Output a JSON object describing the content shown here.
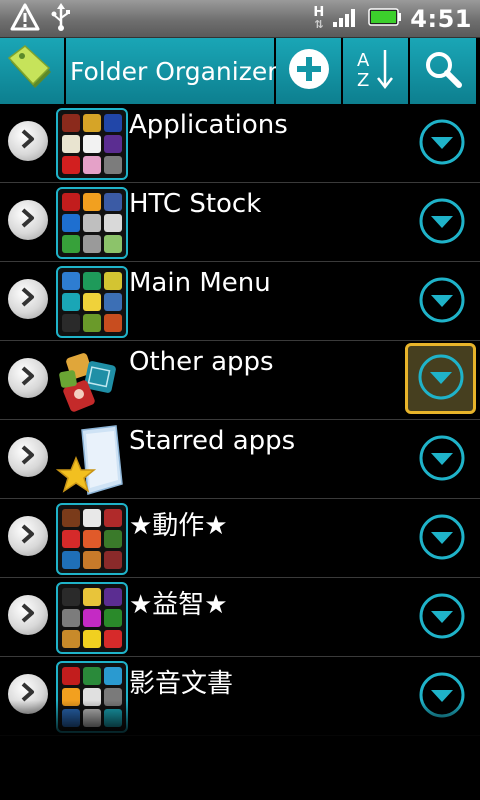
{
  "status_bar": {
    "time": "4:51",
    "network": "H",
    "icons": [
      "warning-icon",
      "usb-icon",
      "h-network-icon",
      "signal-icon",
      "battery-icon"
    ],
    "battery_color": "#3ccf2c"
  },
  "toolbar": {
    "title": "Folder Organizer",
    "accent_color": "#1496a6",
    "buttons": [
      {
        "name": "add-button",
        "icon": "plus-icon"
      },
      {
        "name": "sort-button",
        "icon": "sort-az-icon"
      },
      {
        "name": "search-button",
        "icon": "search-icon"
      }
    ]
  },
  "folders": [
    {
      "label": "Applications",
      "thumb": "grid",
      "selected": false
    },
    {
      "label": "HTC Stock",
      "thumb": "grid",
      "selected": false
    },
    {
      "label": "Main Menu",
      "thumb": "grid",
      "selected": false
    },
    {
      "label": "Other apps",
      "thumb": "other-apps-icon",
      "selected": true
    },
    {
      "label": "Starred apps",
      "thumb": "starred-folder-icon",
      "selected": false
    },
    {
      "label": "★動作★",
      "thumb": "grid",
      "selected": false
    },
    {
      "label": "★益智★",
      "thumb": "grid",
      "selected": false
    },
    {
      "label": "影音文書",
      "thumb": "grid",
      "selected": false
    }
  ]
}
